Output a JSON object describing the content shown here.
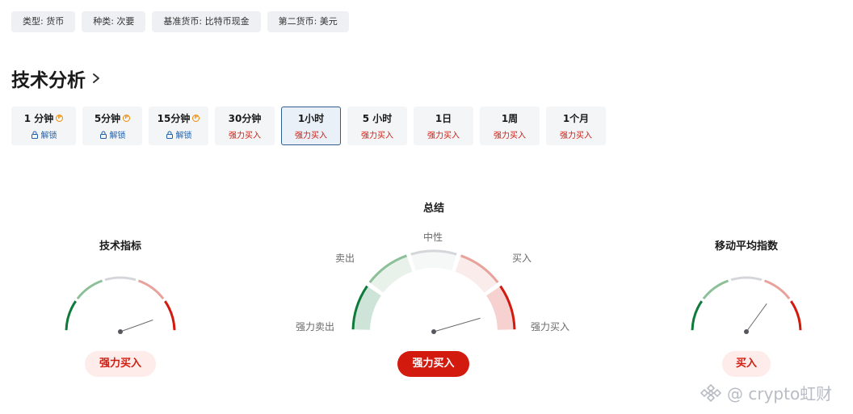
{
  "tags": [
    "类型: 货币",
    "种类: 次要",
    "基准货币: 比特币现金",
    "第二货币: 美元"
  ],
  "section": {
    "title": "技术分析"
  },
  "timeframes": [
    {
      "label": "1 分钟",
      "sub": "解锁",
      "pro": true,
      "locked": true,
      "selected": false
    },
    {
      "label": "5分钟",
      "sub": "解锁",
      "pro": true,
      "locked": true,
      "selected": false
    },
    {
      "label": "15分钟",
      "sub": "解锁",
      "pro": true,
      "locked": true,
      "selected": false
    },
    {
      "label": "30分钟",
      "sub": "强力买入",
      "pro": false,
      "locked": false,
      "selected": false
    },
    {
      "label": "1小时",
      "sub": "强力买入",
      "pro": false,
      "locked": false,
      "selected": true
    },
    {
      "label": "5 小时",
      "sub": "强力买入",
      "pro": false,
      "locked": false,
      "selected": false
    },
    {
      "label": "1日",
      "sub": "强力买入",
      "pro": false,
      "locked": false,
      "selected": false
    },
    {
      "label": "1周",
      "sub": "强力买入",
      "pro": false,
      "locked": false,
      "selected": false
    },
    {
      "label": "1个月",
      "sub": "强力买入",
      "pro": false,
      "locked": false,
      "selected": false
    }
  ],
  "gauges": {
    "technical": {
      "title": "技术指标",
      "result": "强力买入",
      "needle_level": 0.89
    },
    "summary": {
      "title": "总结",
      "result": "强力买入",
      "needle_level": 0.91,
      "labels": {
        "strong_sell": "强力卖出",
        "sell": "卖出",
        "neutral": "中性",
        "buy": "买入",
        "strong_buy": "强力买入"
      }
    },
    "moving_avg": {
      "title": "移动平均指数",
      "result": "买入",
      "needle_level": 0.7
    }
  },
  "colors": {
    "strong_sell": "#0f7a3a",
    "sell": "#8dbf98",
    "neutral": "#d4d6d9",
    "buy": "#e8a19b",
    "strong_buy": "#d21a0e",
    "selected_border": "#2f5d8f"
  },
  "watermark": {
    "text": "@ crypto虹财"
  }
}
